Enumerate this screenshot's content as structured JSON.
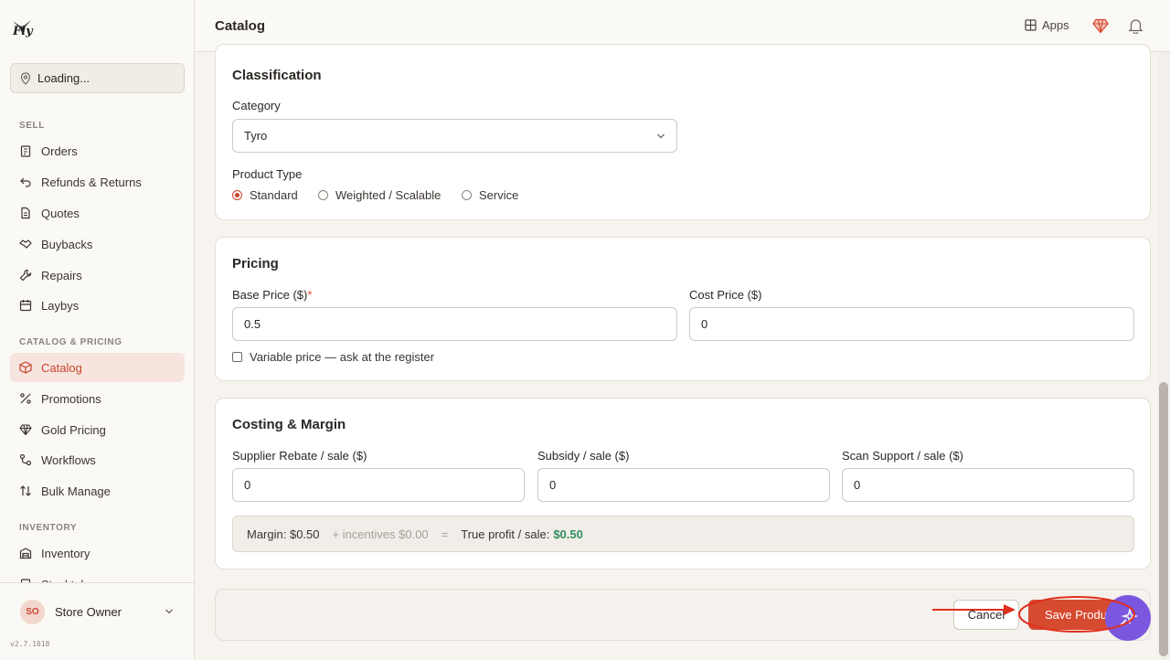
{
  "app": {
    "logo_text": "Fly",
    "version": "v2.7.1018"
  },
  "location": {
    "label": "Loading..."
  },
  "sidebar": {
    "sections": [
      {
        "label": "SELL"
      },
      {
        "label": "CATALOG & PRICING"
      },
      {
        "label": "INVENTORY"
      }
    ],
    "items": [
      {
        "label": "Orders",
        "icon": "clipboard-icon"
      },
      {
        "label": "Refunds & Returns",
        "icon": "undo-icon"
      },
      {
        "label": "Quotes",
        "icon": "document-icon"
      },
      {
        "label": "Buybacks",
        "icon": "handshake-icon"
      },
      {
        "label": "Repairs",
        "icon": "wrench-icon"
      },
      {
        "label": "Laybys",
        "icon": "calendar-icon"
      },
      {
        "label": "Catalog",
        "icon": "box-icon",
        "active": true
      },
      {
        "label": "Promotions",
        "icon": "percent-icon"
      },
      {
        "label": "Gold Pricing",
        "icon": "gem-icon"
      },
      {
        "label": "Workflows",
        "icon": "workflow-icon"
      },
      {
        "label": "Bulk Manage",
        "icon": "sort-icon"
      },
      {
        "label": "Inventory",
        "icon": "warehouse-icon"
      },
      {
        "label": "Stocktake",
        "icon": "clipboard-check-icon"
      }
    ]
  },
  "user": {
    "initials": "SO",
    "name": "Store Owner"
  },
  "header": {
    "title": "Catalog",
    "apps_label": "Apps"
  },
  "classification": {
    "title": "Classification",
    "category_label": "Category",
    "category_value": "Tyro",
    "product_type_label": "Product Type",
    "types": [
      {
        "label": "Standard",
        "selected": true
      },
      {
        "label": "Weighted / Scalable",
        "selected": false
      },
      {
        "label": "Service",
        "selected": false
      }
    ]
  },
  "pricing": {
    "title": "Pricing",
    "base_label": "Base Price ($)",
    "base_required": "*",
    "base_value": "0.5",
    "cost_label": "Cost Price ($)",
    "cost_value": "0",
    "variable_label": "Variable price — ask at the register",
    "variable_checked": false
  },
  "costing": {
    "title": "Costing & Margin",
    "rebate_label": "Supplier Rebate / sale ($)",
    "rebate_value": "0",
    "subsidy_label": "Subsidy / sale ($)",
    "subsidy_value": "0",
    "scan_label": "Scan Support / sale ($)",
    "scan_value": "0",
    "margin_text": "Margin: $0.50",
    "incentives_text": "+ incentives $0.00",
    "equals": "=",
    "profit_label": "True profit / sale:",
    "profit_value": "$0.50"
  },
  "footer": {
    "cancel_label": "Cancel",
    "save_label": "Save Product"
  },
  "colors": {
    "accent": "#d64a30",
    "active_bg": "#f7e4de",
    "profit_green": "#2f8f5b",
    "fab": "#7b57e0"
  }
}
